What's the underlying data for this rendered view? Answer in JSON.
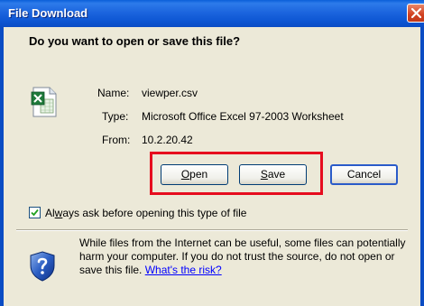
{
  "window": {
    "title": "File Download"
  },
  "question": "Do you want to open or save this file?",
  "file": {
    "name_label": "Name:",
    "name_value": "viewper.csv",
    "type_label": "Type:",
    "type_value": "Microsoft Office Excel 97-2003 Worksheet",
    "from_label": "From:",
    "from_value": "10.2.20.42",
    "icon": "excel-file-icon"
  },
  "buttons": {
    "open_first": "O",
    "open_rest": "pen",
    "save_first": "S",
    "save_rest": "ave",
    "cancel": "Cancel"
  },
  "checkbox": {
    "checked": true,
    "label_pre": "Al",
    "label_u": "w",
    "label_post": "ays ask before opening this type of file"
  },
  "info": {
    "text": "While files from the Internet can be useful, some files can potentially harm your computer. If you do not trust the source, do not open or save this file. ",
    "link": "What's the risk?",
    "icon": "shield-question-icon"
  },
  "colors": {
    "titlebar": "#0a5fd8",
    "dialog_bg": "#ece9d8",
    "highlight": "#e60c1e",
    "link": "#0000ff"
  }
}
